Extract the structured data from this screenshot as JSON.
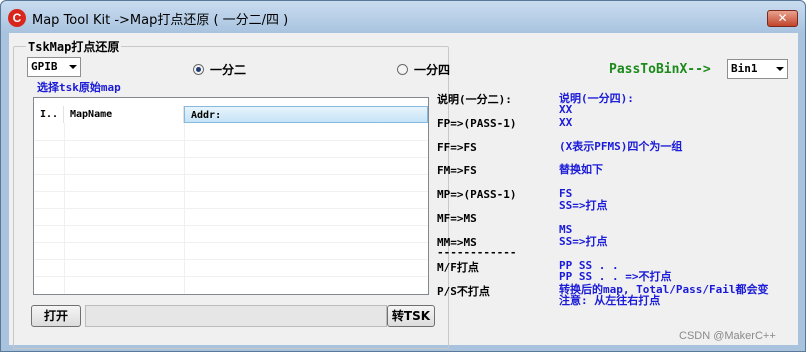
{
  "window": {
    "title": "Map Tool Kit ->Map打点还原 ( 一分二/四 )",
    "close_glyph": "✕"
  },
  "group": {
    "label": "TskMap打点还原"
  },
  "format_combo": {
    "value": "GPIB"
  },
  "radios": [
    {
      "label": "一分二",
      "checked": true
    },
    {
      "label": "一分四",
      "checked": false
    }
  ],
  "pass_to_bin": {
    "label": "PassToBinX-->",
    "value": "Bin1"
  },
  "select_label": "选择tsk原始map",
  "listview": {
    "columns": [
      "I..",
      "MapName",
      "Addr:"
    ]
  },
  "buttons": {
    "open": "打开",
    "convert": "转TSK"
  },
  "rules_left": [
    "说明(一分二):",
    "FP=>(PASS-1)",
    "FF=>FS",
    "FM=>FS",
    "MP=>(PASS-1)",
    "MF=>MS",
    "MM=>MS",
    "------------",
    "M/F打点",
    "P/S不打点"
  ],
  "rules_right": [
    "说明(一分四):",
    "XX",
    "XX",
    "(X表示PFMS)四个为一组",
    "替换如下",
    "FS",
    "SS=>打点",
    "MS",
    "SS=>打点",
    "PP   SS   . .",
    "PP   SS   . . =>不打点",
    "转换后的map, Total/Pass/Fail都会变",
    "注意: 从左往右打点"
  ],
  "watermark": "CSDN @MakerC++"
}
